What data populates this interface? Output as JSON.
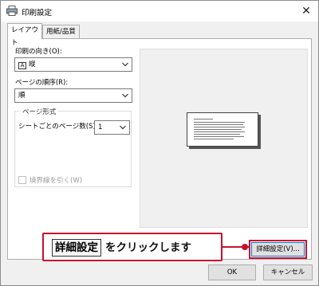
{
  "window": {
    "title": "印刷設定",
    "close_glyph": "✕",
    "title_icon": "printer-icon"
  },
  "tabs": [
    {
      "label": "レイアウト",
      "active": true
    },
    {
      "label": "用紙/品質",
      "active": false
    }
  ],
  "layout": {
    "orientation_label": "印刷の向き(O):",
    "orientation_value": "縦",
    "page_order_label": "ページの順序(R):",
    "page_order_value": "順",
    "page_format_group": "ページ形式",
    "pages_per_sheet_label": "シートごとのページ数(S)",
    "pages_per_sheet_value": "1",
    "draw_borders_label": "境界線を引く(W)",
    "draw_borders_checked": false,
    "draw_borders_enabled": false
  },
  "buttons": {
    "advanced": "詳細設定(V)...",
    "ok": "OK",
    "cancel": "キャンセル"
  },
  "callout": {
    "key_label": "詳細設定",
    "text": "をクリックします"
  },
  "colors": {
    "highlight": "#c8102e",
    "focus": "#0078d7"
  }
}
